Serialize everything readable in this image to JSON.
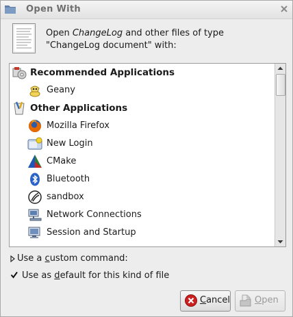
{
  "window": {
    "title": "Open With",
    "folder_icon": "folder-icon",
    "close_icon": "close-icon"
  },
  "header": {
    "icon": "text-document-icon",
    "prefix": "Open ",
    "filename": "ChangeLog",
    "suffix": " and other files of type \"ChangeLog document\" with:"
  },
  "list": {
    "rows": [
      {
        "label": "Recommended Applications",
        "icon": "recommended-icon",
        "header": true
      },
      {
        "label": "Geany",
        "icon": "geany-icon",
        "header": false
      },
      {
        "label": "Other Applications",
        "icon": "other-apps-icon",
        "header": true
      },
      {
        "label": "Mozilla Firefox",
        "icon": "firefox-icon",
        "header": false
      },
      {
        "label": "New Login",
        "icon": "new-login-icon",
        "header": false
      },
      {
        "label": "CMake",
        "icon": "cmake-icon",
        "header": false
      },
      {
        "label": "Bluetooth",
        "icon": "bluetooth-icon",
        "header": false
      },
      {
        "label": "sandbox",
        "icon": "sandbox-icon",
        "header": false
      },
      {
        "label": "Network Connections",
        "icon": "network-connections-icon",
        "header": false
      },
      {
        "label": "Session and Startup",
        "icon": "session-startup-icon",
        "header": false
      }
    ],
    "scroll_position": 0.03
  },
  "custom_command": {
    "label_pre": "Use a ",
    "label_u": "c",
    "label_post": "ustom command:",
    "expanded": false
  },
  "default_check": {
    "label_pre": "Use as ",
    "label_u": "d",
    "label_post": "efault for this kind of file",
    "checked": true
  },
  "buttons": {
    "cancel_u": "C",
    "cancel_rest": "ancel",
    "open_u": "O",
    "open_rest": "pen",
    "open_enabled": false
  },
  "colors": {
    "cancel_icon": "#cc1f1f",
    "firefox_orange": "#e66a00",
    "bluetooth_blue": "#2a62c9"
  }
}
